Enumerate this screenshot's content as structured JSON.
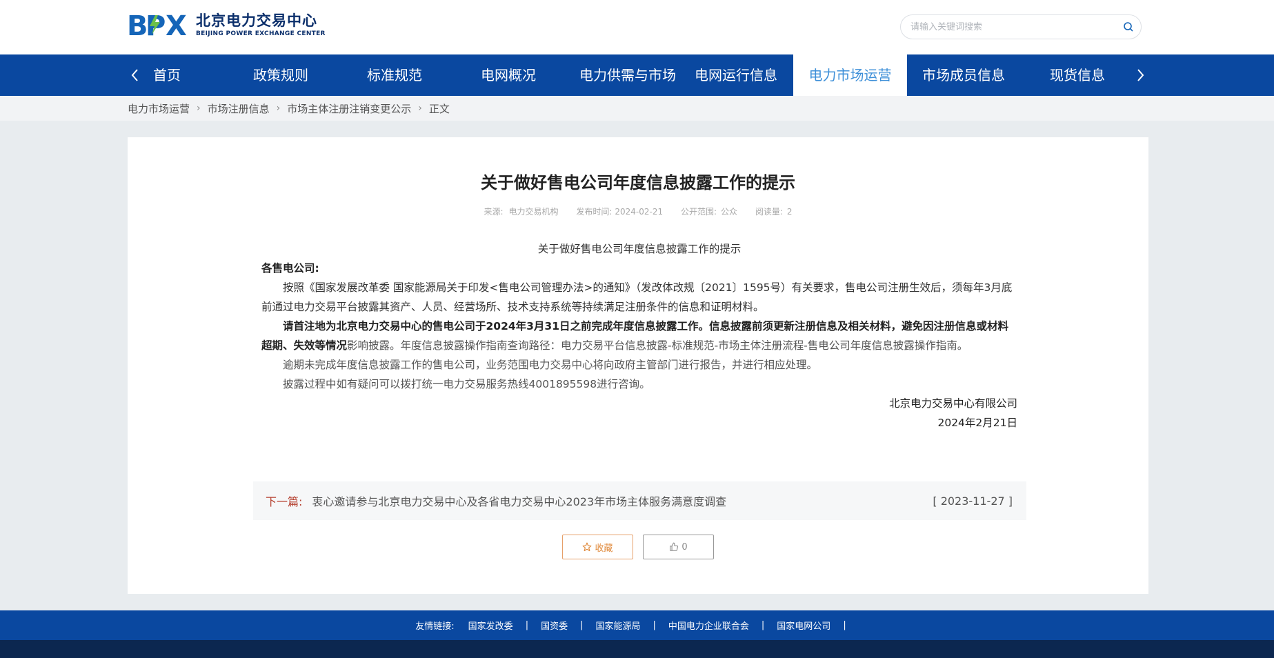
{
  "header": {
    "logo_mark": "BPX",
    "logo_cn": "北京电力交易中心",
    "logo_en": "BEIJING POWER EXCHANGE CENTER",
    "search_placeholder": "请输入关键词搜索"
  },
  "nav": {
    "items": [
      "首页",
      "政策规则",
      "标准规范",
      "电网概况",
      "电力供需与市场",
      "电网运行信息",
      "电力市场运营",
      "市场成员信息",
      "现货信息"
    ],
    "active_index": 6
  },
  "breadcrumb": [
    "电力市场运营",
    "市场注册信息",
    "市场主体注册注销变更公示",
    "正文"
  ],
  "article": {
    "title": "关于做好售电公司年度信息披露工作的提示",
    "meta": {
      "source_label": "来源:",
      "source": "电力交易机构",
      "date_label": "发布时间:",
      "date": "2024-02-21",
      "scope_label": "公开范围:",
      "scope": "公众",
      "views_label": "阅读量:",
      "views": "2"
    },
    "heading": "关于做好售电公司年度信息披露工作的提示",
    "salutation": "各售电公司:",
    "p1": "按照《国家发展改革委 国家能源局关于印发<售电公司管理办法>的通知》（发改体改规〔2021〕1595号）有关要求，售电公司注册生效后，须每年3月底前通过电力交易平台披露其资产、人员、经营场所、技术支持系统等持续满足注册条件的信息和证明材料。",
    "p2_bold": "请首注地为北京电力交易中心的售电公司于2024年3月31日之前完成年度信息披露工作。信息披露前须更新注册信息及相关材料，避免因注册信息或材料超期、失效等情况",
    "p2_rest": "影响披露。年度信息披露操作指南查询路径：电力交易平台信息披露-标准规范-市场主体注册流程-售电公司年度信息披露操作指南。",
    "p3": "逾期未完成年度信息披露工作的售电公司，业务范围电力交易中心将向政府主管部门进行报告，并进行相应处理。",
    "p4": "披露过程中如有疑问可以拨打统一电力交易服务热线4001895598进行咨询。",
    "signature": "北京电力交易中心有限公司",
    "sign_date": "2024年2月21日"
  },
  "next": {
    "label": "下一篇:",
    "title": "衷心邀请参与北京电力交易中心及各省电力交易中心2023年市场主体服务满意度调查",
    "date": "[ 2023-11-27 ]"
  },
  "buttons": {
    "favorite": "收藏",
    "like_count": "0"
  },
  "footer": {
    "label": "友情链接:",
    "links": [
      "国家发改委",
      "国资委",
      "国家能源局",
      "中国电力企业联合会",
      "国家电网公司"
    ],
    "separator": "|"
  },
  "colors": {
    "nav_bg": "#0a48a0",
    "active_tab_text": "#3d8fd8",
    "next_label": "#b5402f",
    "favorite_accent": "#e08a3c",
    "footer_bottom": "#0c2750"
  }
}
